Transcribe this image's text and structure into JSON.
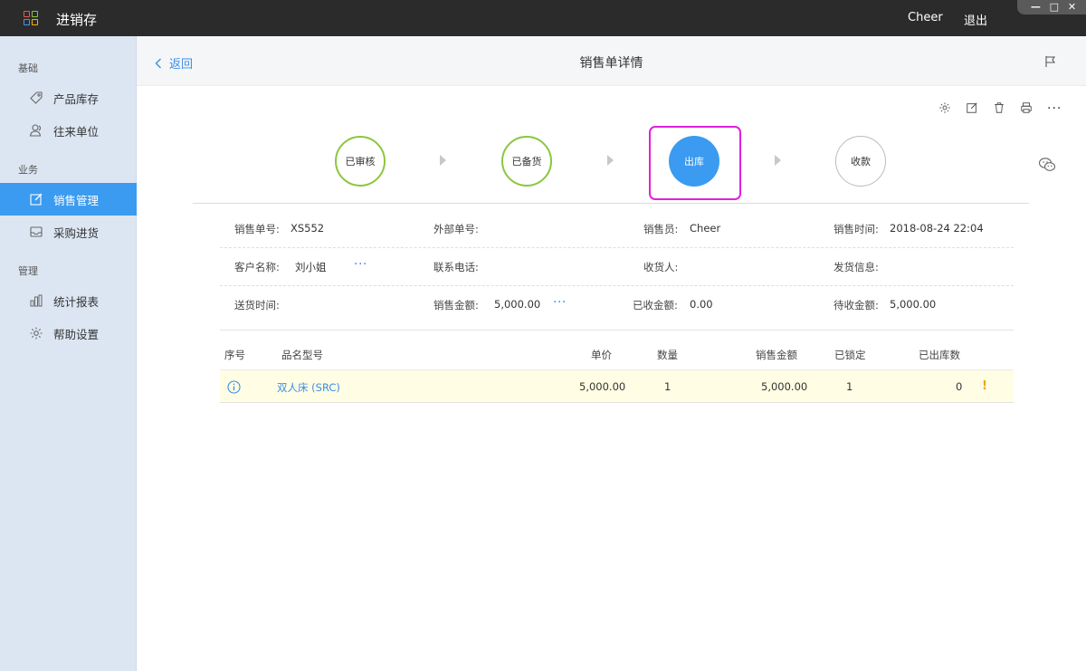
{
  "app": {
    "title": "进销存",
    "user": "Cheer",
    "logout": "退出"
  },
  "window_controls": {
    "minimize": "—",
    "maximize": "□",
    "close": "✕"
  },
  "sidebar": {
    "sections": [
      "基础",
      "业务",
      "管理"
    ],
    "items": [
      {
        "label": "产品库存",
        "icon": "tag-icon"
      },
      {
        "label": "往来单位",
        "icon": "contacts-icon"
      },
      {
        "label": "销售管理",
        "icon": "edit-icon",
        "active": true
      },
      {
        "label": "采购进货",
        "icon": "inbox-icon"
      },
      {
        "label": "统计报表",
        "icon": "bar-chart-icon"
      },
      {
        "label": "帮助设置",
        "icon": "gear-icon"
      }
    ]
  },
  "header": {
    "back": "返回",
    "title": "销售单详情"
  },
  "toolbar": [
    "settings-icon",
    "edit-icon",
    "trash-icon",
    "print-icon",
    "more-icon"
  ],
  "more_text": "···",
  "steps": [
    {
      "label": "已审核",
      "state": "done"
    },
    {
      "label": "已备货",
      "state": "done"
    },
    {
      "label": "出库",
      "state": "current"
    },
    {
      "label": "收款",
      "state": "pending"
    }
  ],
  "info": {
    "order_no_label": "销售单号:",
    "order_no": "XS552",
    "external_no_label": "外部单号:",
    "external_no": "",
    "salesperson_label": "销售员:",
    "salesperson": "Cheer",
    "sale_time_label": "销售时间:",
    "sale_time": "2018-08-24 22:04",
    "customer_label": "客户名称:",
    "customer": "刘小姐",
    "phone_label": "联系电话:",
    "phone": "",
    "receiver_label": "收货人:",
    "receiver": "",
    "ship_info_label": "发货信息:",
    "ship_info": "",
    "delivery_time_label": "送货时间:",
    "delivery_time": "",
    "amount_label": "销售金额:",
    "amount": "5,000.00",
    "received_label": "已收金额:",
    "received": "0.00",
    "pending_label": "待收金额:",
    "pending": "5,000.00",
    "more": "···"
  },
  "table": {
    "headers": {
      "index": "序号",
      "product": "品名型号",
      "price": "单价",
      "qty": "数量",
      "amount": "销售金额",
      "locked": "已锁定",
      "shipped": "已出库数"
    },
    "rows": [
      {
        "product": "双人床 (SRC)",
        "price": "5,000.00",
        "qty": "1",
        "amount": "5,000.00",
        "locked": "1",
        "shipped": "0",
        "warning": "!"
      }
    ]
  },
  "colors": {
    "accent": "#3a9bf0",
    "done_step": "#8cc63f",
    "highlight": "#e020e0",
    "row_bg": "#fffde4"
  }
}
